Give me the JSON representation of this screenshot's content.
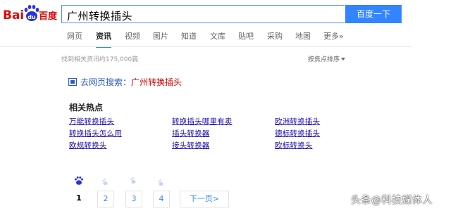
{
  "brand": {
    "latin": "Bai",
    "paw_letters": "du",
    "cjk": "百度",
    "red": "#e10602",
    "blue": "#2932e1"
  },
  "search": {
    "query": "广州转换插头",
    "button_label": "百度一下"
  },
  "tabs": [
    {
      "label": "网页",
      "active": false
    },
    {
      "label": "资讯",
      "active": true
    },
    {
      "label": "视频",
      "active": false
    },
    {
      "label": "图片",
      "active": false
    },
    {
      "label": "知道",
      "active": false
    },
    {
      "label": "文库",
      "active": false
    },
    {
      "label": "贴吧",
      "active": false
    },
    {
      "label": "采购",
      "active": false
    },
    {
      "label": "地图",
      "active": false
    },
    {
      "label": "更多»",
      "active": false
    }
  ],
  "results": {
    "count_text": "找到相关资讯约175,000篇",
    "sort_label": "按焦点排序"
  },
  "web_search": {
    "label": "去网页搜索：",
    "query": "广州转换插头"
  },
  "related": {
    "title": "相关热点",
    "links": [
      "万能转换插头",
      "转换插头哪里有卖",
      "欧洲转换插头",
      "转换插头怎么用",
      "插头转换器",
      "德标转换插头",
      "欧规转换头",
      "接头转换器",
      "欧标转换头"
    ]
  },
  "pagination": {
    "pages": [
      "1",
      "2",
      "3",
      "4"
    ],
    "current": "1",
    "next_label": "下一页>"
  },
  "watermark": "头条@科技媒体人"
}
